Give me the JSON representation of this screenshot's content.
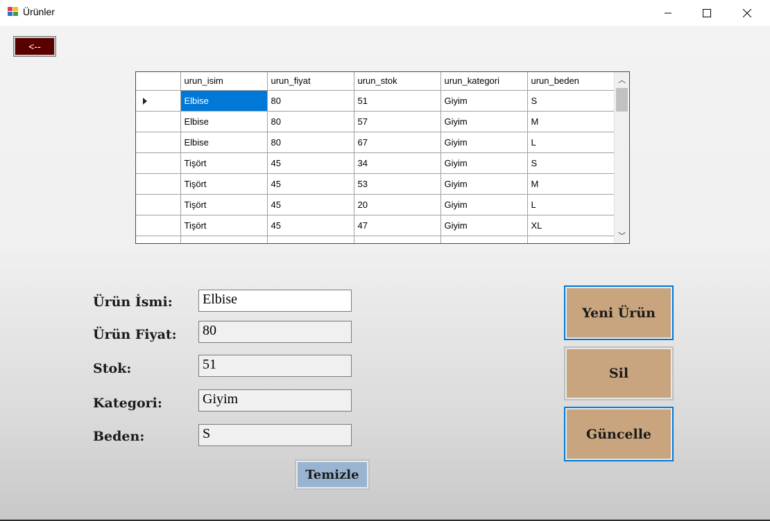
{
  "window": {
    "title": "Ürünler"
  },
  "back_button": {
    "label": "<--"
  },
  "grid": {
    "columns": [
      "urun_isim",
      "urun_fiyat",
      "urun_stok",
      "urun_kategori",
      "urun_beden"
    ],
    "rows": [
      [
        "Elbise",
        "80",
        "51",
        "Giyim",
        "S"
      ],
      [
        "Elbise",
        "80",
        "57",
        "Giyim",
        "M"
      ],
      [
        "Elbise",
        "80",
        "67",
        "Giyim",
        "L"
      ],
      [
        "Tişört",
        "45",
        "34",
        "Giyim",
        "S"
      ],
      [
        "Tişört",
        "45",
        "53",
        "Giyim",
        "M"
      ],
      [
        "Tişört",
        "45",
        "20",
        "Giyim",
        "L"
      ],
      [
        "Tişört",
        "45",
        "47",
        "Giyim",
        "XL"
      ],
      [
        "",
        "",
        "",
        "",
        ""
      ]
    ],
    "selected_row": 0
  },
  "form": {
    "labels": {
      "name": "Ürün İsmi:",
      "price": "Ürün Fiyat:",
      "stock": "Stok:",
      "category": "Kategori:",
      "size": "Beden:"
    },
    "values": {
      "name": "Elbise",
      "price": "80",
      "stock": "51",
      "category": "Giyim",
      "size": "S"
    }
  },
  "actions": {
    "new": "Yeni Ürün",
    "delete": "Sil",
    "update": "Güncelle",
    "clear": "Temizle"
  },
  "colors": {
    "back_button": "#5a0000",
    "action_button": "#c8a57f",
    "clear_button": "#99b4d1",
    "selection": "#0078d7"
  }
}
